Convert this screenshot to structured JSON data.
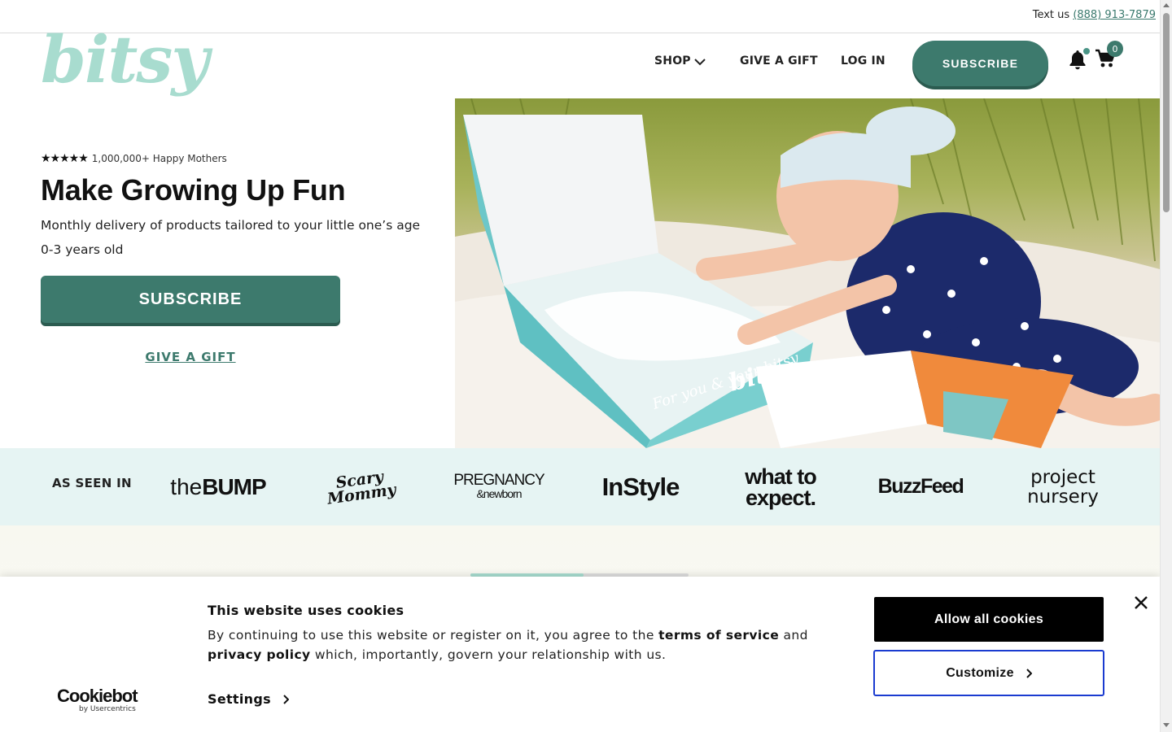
{
  "topbar": {
    "text_prefix": "Text us",
    "phone": "(888) 913-7879"
  },
  "header": {
    "logo": "bitsy",
    "nav": {
      "shop": "SHOP",
      "give_gift": "GIVE A GIFT",
      "login": "LOG IN"
    },
    "subscribe": "SUBSCRIBE",
    "cart_count": "0"
  },
  "hero": {
    "rating_stars": "★★★★★",
    "rating_text": "1,000,000+ Happy Mothers",
    "title": "Make Growing Up Fun",
    "description": "Monthly delivery of products tailored to your little one’s age 0-3 years old",
    "subscribe": "SUBSCRIBE",
    "give_gift": "GIVE A GIFT",
    "image_box_text": "For you & your bitsy",
    "image_box_brand": "bitsy"
  },
  "press": {
    "label": "AS SEEN IN",
    "bump_the": "the",
    "bump_main": "BUMP",
    "scary_line1": "Scary",
    "scary_line2": "Mommy",
    "preg_line1": "PREGNANCY",
    "preg_line2": "&newborn",
    "instyle": "InStyle",
    "wte_line1": "what to",
    "wte_line2": "expect.",
    "buzzfeed": "BuzzFeed",
    "project_line1": "project",
    "project_line2": "nursery"
  },
  "carousel": {
    "progress": 0.52
  },
  "cookie": {
    "title": "This website uses cookies",
    "text_1": "By continuing to use this website or register on it, you agree to the ",
    "terms": "terms of service",
    "text_2": " and ",
    "privacy": "privacy policy",
    "text_3": " which, importantly, govern your relationship with us.",
    "settings": "Settings",
    "allow_all": "Allow all cookies",
    "customize": "Customize",
    "cb_logo": "Cookiebot",
    "cb_sub": "by Usercentrics"
  },
  "colors": {
    "brand": "#3d7a6d",
    "logo": "#a8dccf",
    "strip": "#e6f4f3",
    "focus": "#1a3bd0"
  }
}
